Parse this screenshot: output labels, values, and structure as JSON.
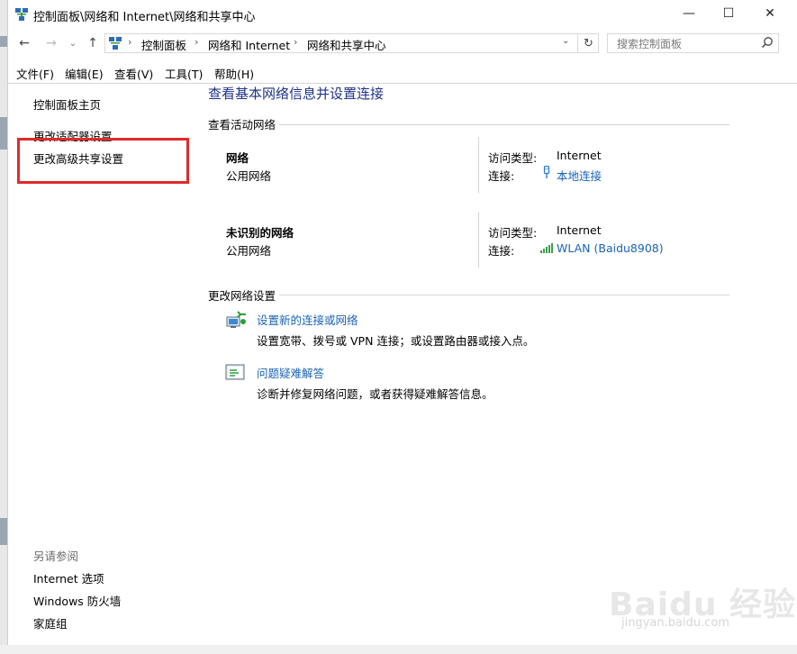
{
  "window": {
    "title": "控制面板\\网络和 Internet\\网络和共享中心",
    "controls": {
      "minimize": "—",
      "maximize": "☐",
      "close": "✕"
    }
  },
  "nav": {
    "back": "←",
    "forward": "→",
    "recent": "⌄",
    "up": "↑",
    "breadcrumbs": [
      "控制面板",
      "网络和 Internet",
      "网络和共享中心"
    ],
    "separator": "›",
    "refresh": "↻",
    "dropdown": "⌄"
  },
  "search": {
    "placeholder": "搜索控制面板"
  },
  "menu": [
    "文件(F)",
    "编辑(E)",
    "查看(V)",
    "工具(T)",
    "帮助(H)"
  ],
  "sidebar": {
    "links": [
      "控制面板主页",
      "更改适配器设置",
      "更改高级共享设置"
    ],
    "see_also_title": "另请参阅",
    "see_also": [
      "Internet 选项",
      "Windows 防火墙",
      "家庭组"
    ]
  },
  "main": {
    "heading": "查看基本网络信息并设置连接",
    "active_section": "查看活动网络",
    "networks": [
      {
        "name": "网络",
        "type": "公用网络",
        "access_label": "访问类型:",
        "access_value": "Internet",
        "conn_label": "连接:",
        "conn_value": "本地连接",
        "conn_icon": "ethernet-icon"
      },
      {
        "name": "未识别的网络",
        "type": "公用网络",
        "access_label": "访问类型:",
        "access_value": "Internet",
        "conn_label": "连接:",
        "conn_value": "WLAN (Baidu8908)",
        "conn_icon": "wifi-signal-icon"
      }
    ],
    "change_section": "更改网络设置",
    "tasks": [
      {
        "title": "设置新的连接或网络",
        "desc": "设置宽带、拨号或 VPN 连接；或设置路由器或接入点。",
        "icon": "new-connection-icon"
      },
      {
        "title": "问题疑难解答",
        "desc": "诊断并修复网络问题，或者获得疑难解答信息。",
        "icon": "troubleshoot-icon"
      }
    ]
  },
  "watermark": {
    "brand": "Baidu 经验",
    "url": "jingyan.baidu.com"
  },
  "colors": {
    "link": "#1a63b8",
    "heading": "#1e3287",
    "highlight_box": "#e02b2b"
  }
}
